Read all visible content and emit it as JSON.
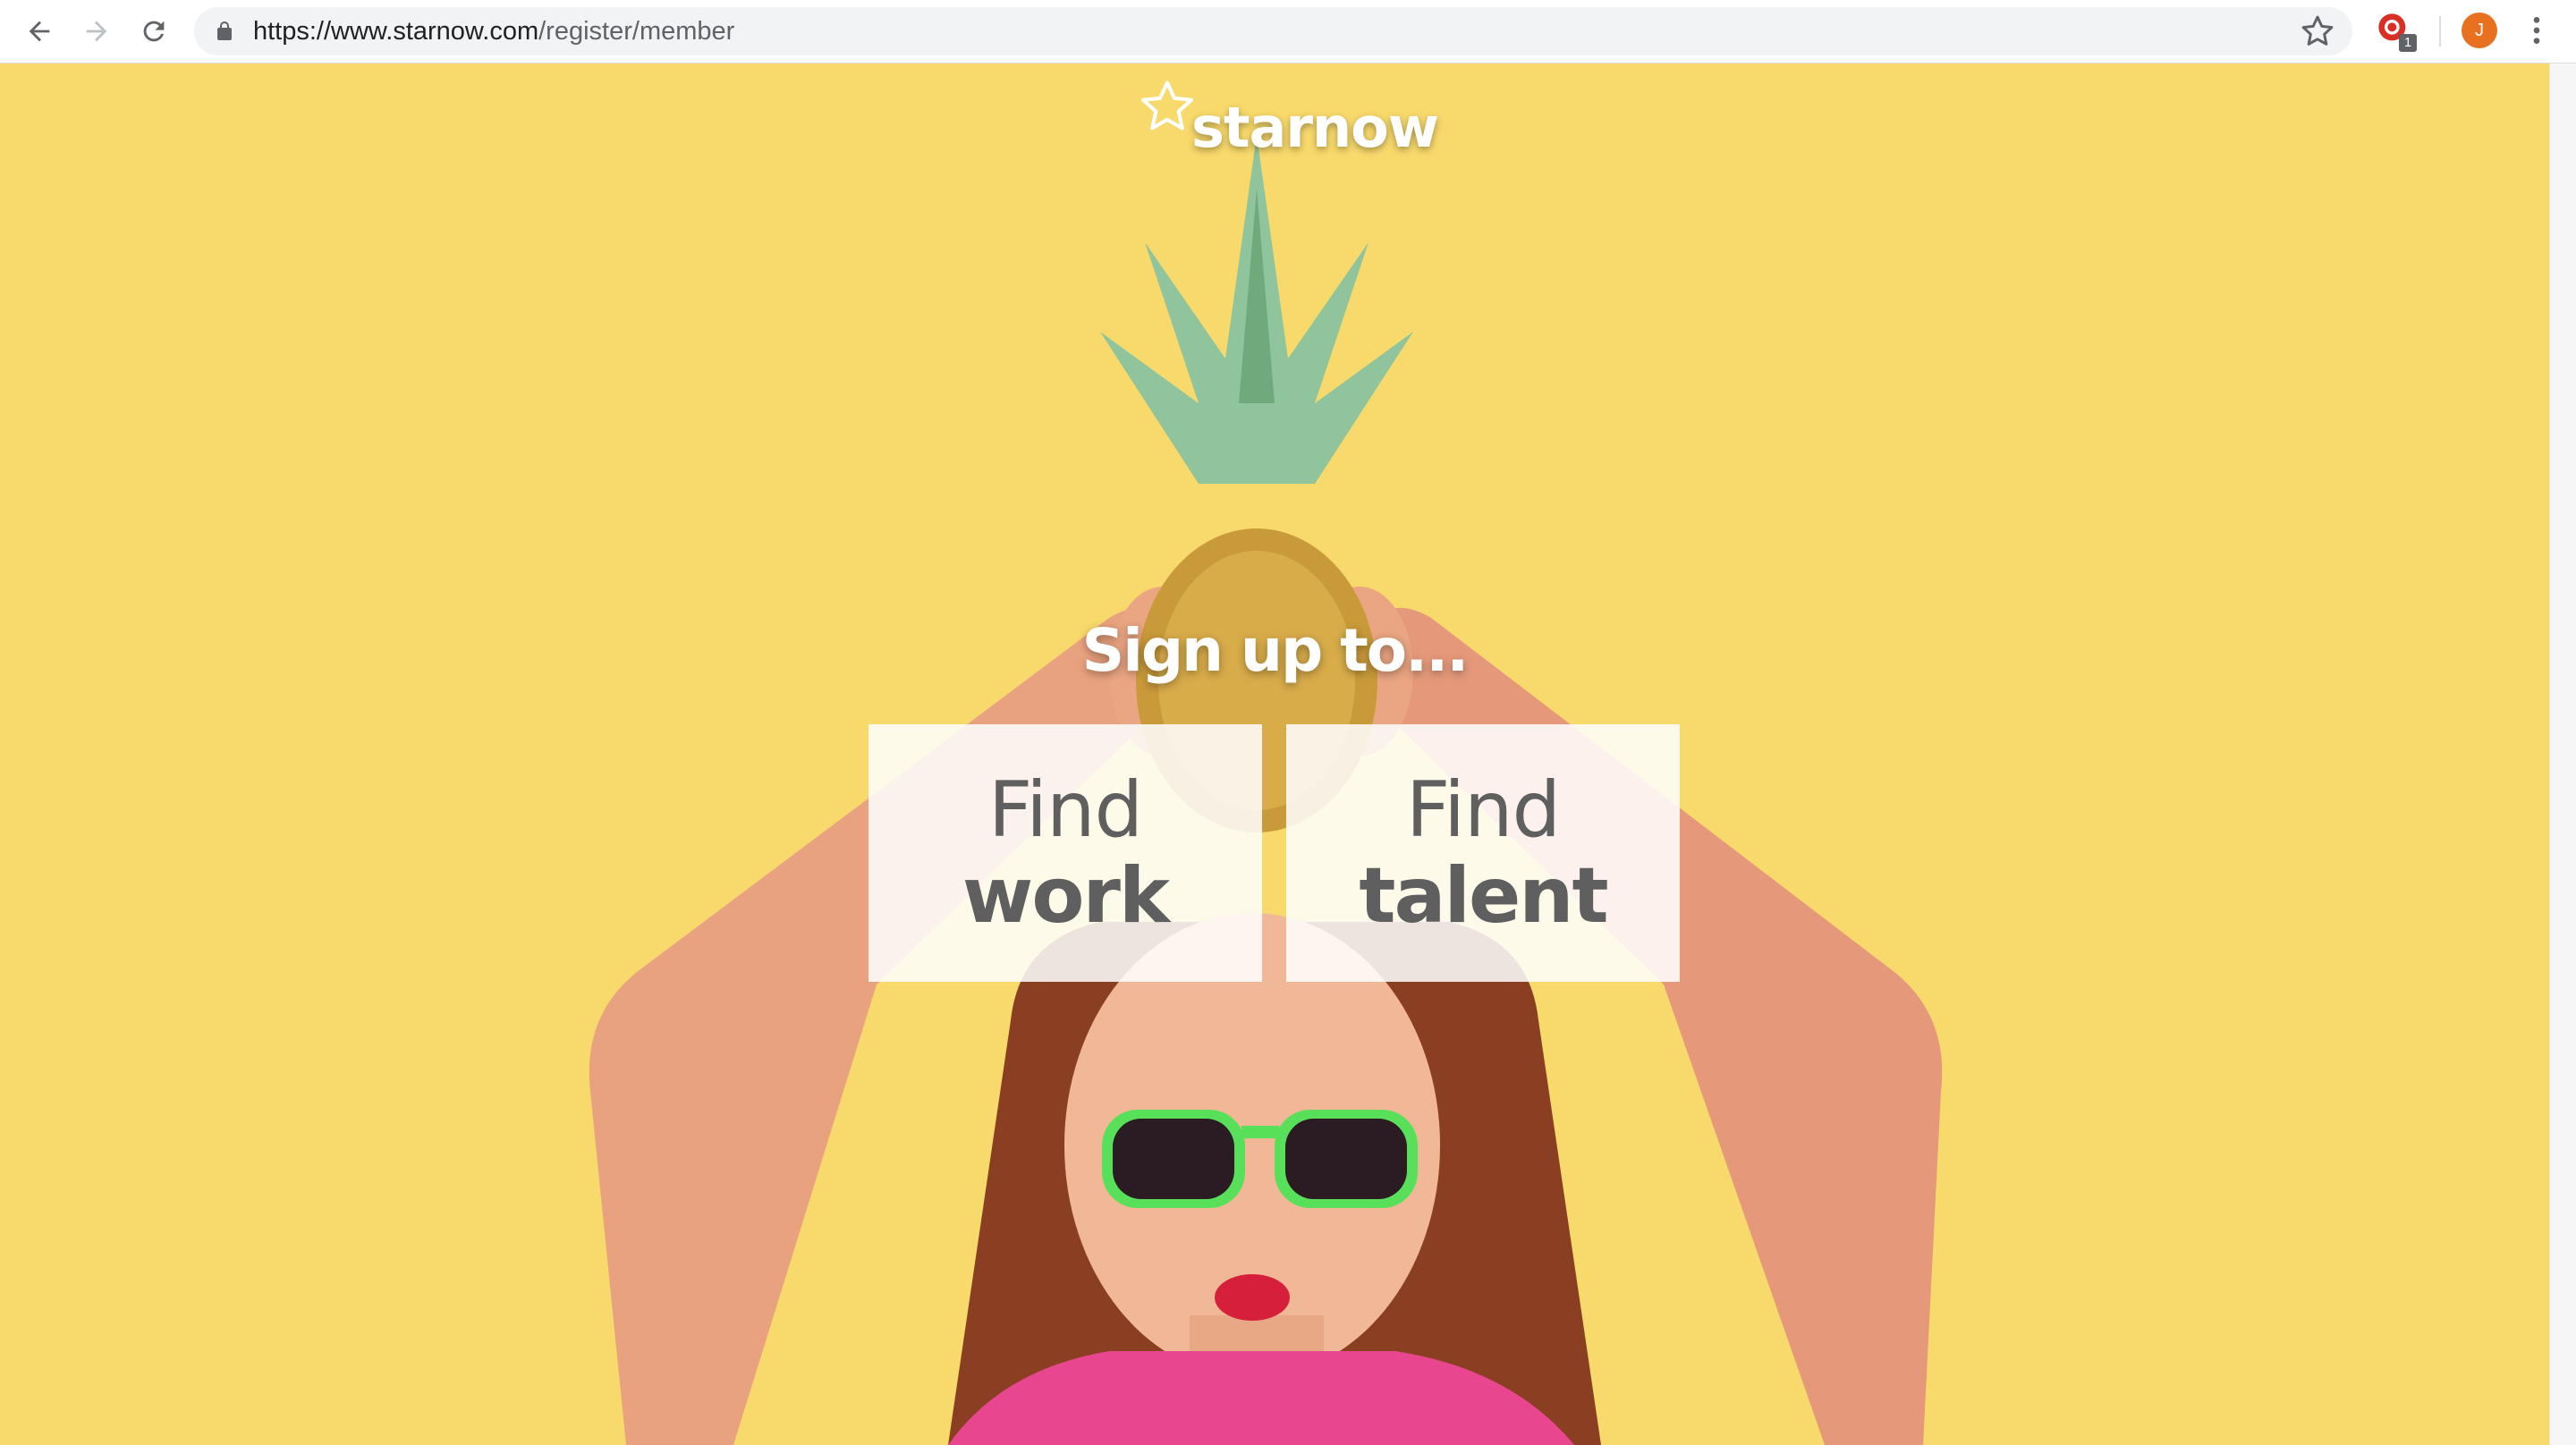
{
  "browser": {
    "url_host": "https://www.starnow.com",
    "url_path": "/register/member",
    "extension_badge": "1",
    "profile_initial": "J",
    "icons": [
      "back-icon",
      "forward-icon",
      "reload-icon",
      "lock-icon",
      "bookmark-star-icon",
      "extension-icon",
      "kebab-menu-icon"
    ]
  },
  "page": {
    "logo_text": "starnow",
    "headline": "Sign up to...",
    "cards": [
      {
        "line1": "Find",
        "line2": "work"
      },
      {
        "line1": "Find",
        "line2": "talent"
      }
    ]
  },
  "colors": {
    "background": "#f8d96b",
    "card_text": "#5f5f5f",
    "avatar": "#e8711f"
  }
}
